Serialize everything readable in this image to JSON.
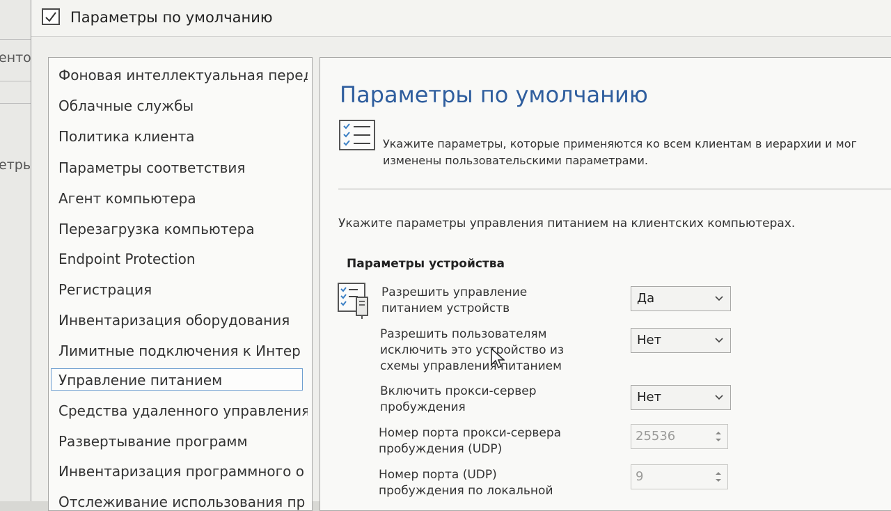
{
  "background": {
    "fragments": [
      "енто",
      "етры"
    ]
  },
  "window": {
    "title": "Параметры по умолчанию"
  },
  "nav": {
    "items": [
      {
        "label": "Фоновая интеллектуальная переда"
      },
      {
        "label": "Облачные службы"
      },
      {
        "label": "Политика клиента"
      },
      {
        "label": "Параметры соответствия"
      },
      {
        "label": "Агент компьютера"
      },
      {
        "label": "Перезагрузка компьютера"
      },
      {
        "label": "Endpoint Protection"
      },
      {
        "label": "Регистрация"
      },
      {
        "label": "Инвентаризация оборудования"
      },
      {
        "label": "Лимитные подключения к Интер"
      },
      {
        "label": "Управление питанием",
        "selected": true
      },
      {
        "label": "Средства удаленного управления"
      },
      {
        "label": "Развертывание программ"
      },
      {
        "label": "Инвентаризация программного о"
      },
      {
        "label": "Отслеживание использования пр"
      }
    ]
  },
  "content": {
    "page_title": "Параметры по умолчанию",
    "description_line1": "Укажите параметры, которые применяются ко всем клиентам в иерархии и мог",
    "description_line2": "изменены пользовательскими параметрами.",
    "instruction": "Укажите параметры управления питанием на клиентских компьютерах.",
    "section_title": "Параметры устройства",
    "settings": [
      {
        "label_line1": "Разрешить управление",
        "label_line2": "питанием устройств",
        "value": "Да"
      },
      {
        "label_line1": "Разрешить пользователям",
        "label_line2": "исключить это устройство из",
        "label_line3": "схемы управления питанием",
        "value": "Нет"
      },
      {
        "label_line1": "Включить прокси-сервер",
        "label_line2": "пробуждения",
        "value": "Нет"
      },
      {
        "label_line1": "Номер порта прокси-сервера",
        "label_line2": "пробуждения (UDP)",
        "value": "25536"
      },
      {
        "label_line1": "Номер порта (UDP)",
        "label_line2": "пробуждения по локальной",
        "value": "9"
      }
    ]
  }
}
